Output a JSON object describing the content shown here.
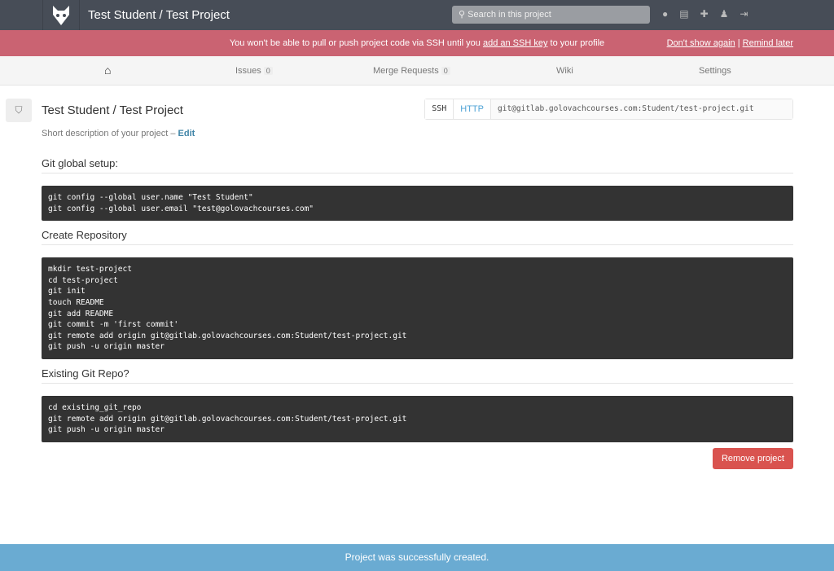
{
  "header": {
    "title": "Test Student / Test Project",
    "search_placeholder": "Search in this project",
    "icons": [
      "globe-icon",
      "copy-icon",
      "plus-icon",
      "user-icon",
      "sign-out-icon"
    ]
  },
  "alert": {
    "text_before": "You won't be able to pull or push project code via SSH until you ",
    "link": "add an SSH key",
    "text_after": " to your profile",
    "dont_show": "Don't show again",
    "sep": " | ",
    "remind": "Remind later"
  },
  "nav": {
    "issues": "Issues",
    "issues_count": "0",
    "mr": "Merge Requests",
    "mr_count": "0",
    "wiki": "Wiki",
    "settings": "Settings"
  },
  "project": {
    "title": "Test Student / Test Project",
    "ssh": "SSH",
    "http": "HTTP",
    "url": "git@gitlab.golovachcourses.com:Student/test-project.git",
    "desc": "Short description of your project – ",
    "edit": "Edit"
  },
  "sections": [
    {
      "title": "Git global setup:",
      "code": "git config --global user.name \"Test Student\"\ngit config --global user.email \"test@golovachcourses.com\""
    },
    {
      "title": "Create Repository",
      "code": "mkdir test-project\ncd test-project\ngit init\ntouch README\ngit add README\ngit commit -m 'first commit'\ngit remote add origin git@gitlab.golovachcourses.com:Student/test-project.git\ngit push -u origin master"
    },
    {
      "title": "Existing Git Repo?",
      "code": "cd existing_git_repo\ngit remote add origin git@gitlab.golovachcourses.com:Student/test-project.git\ngit push -u origin master"
    }
  ],
  "remove_label": "Remove project",
  "flash": "Project was successfully created.",
  "colors": {
    "topbar": "#474d57",
    "alert": "#ca6372",
    "danger": "#d9534f",
    "flash": "#6aabd2"
  }
}
